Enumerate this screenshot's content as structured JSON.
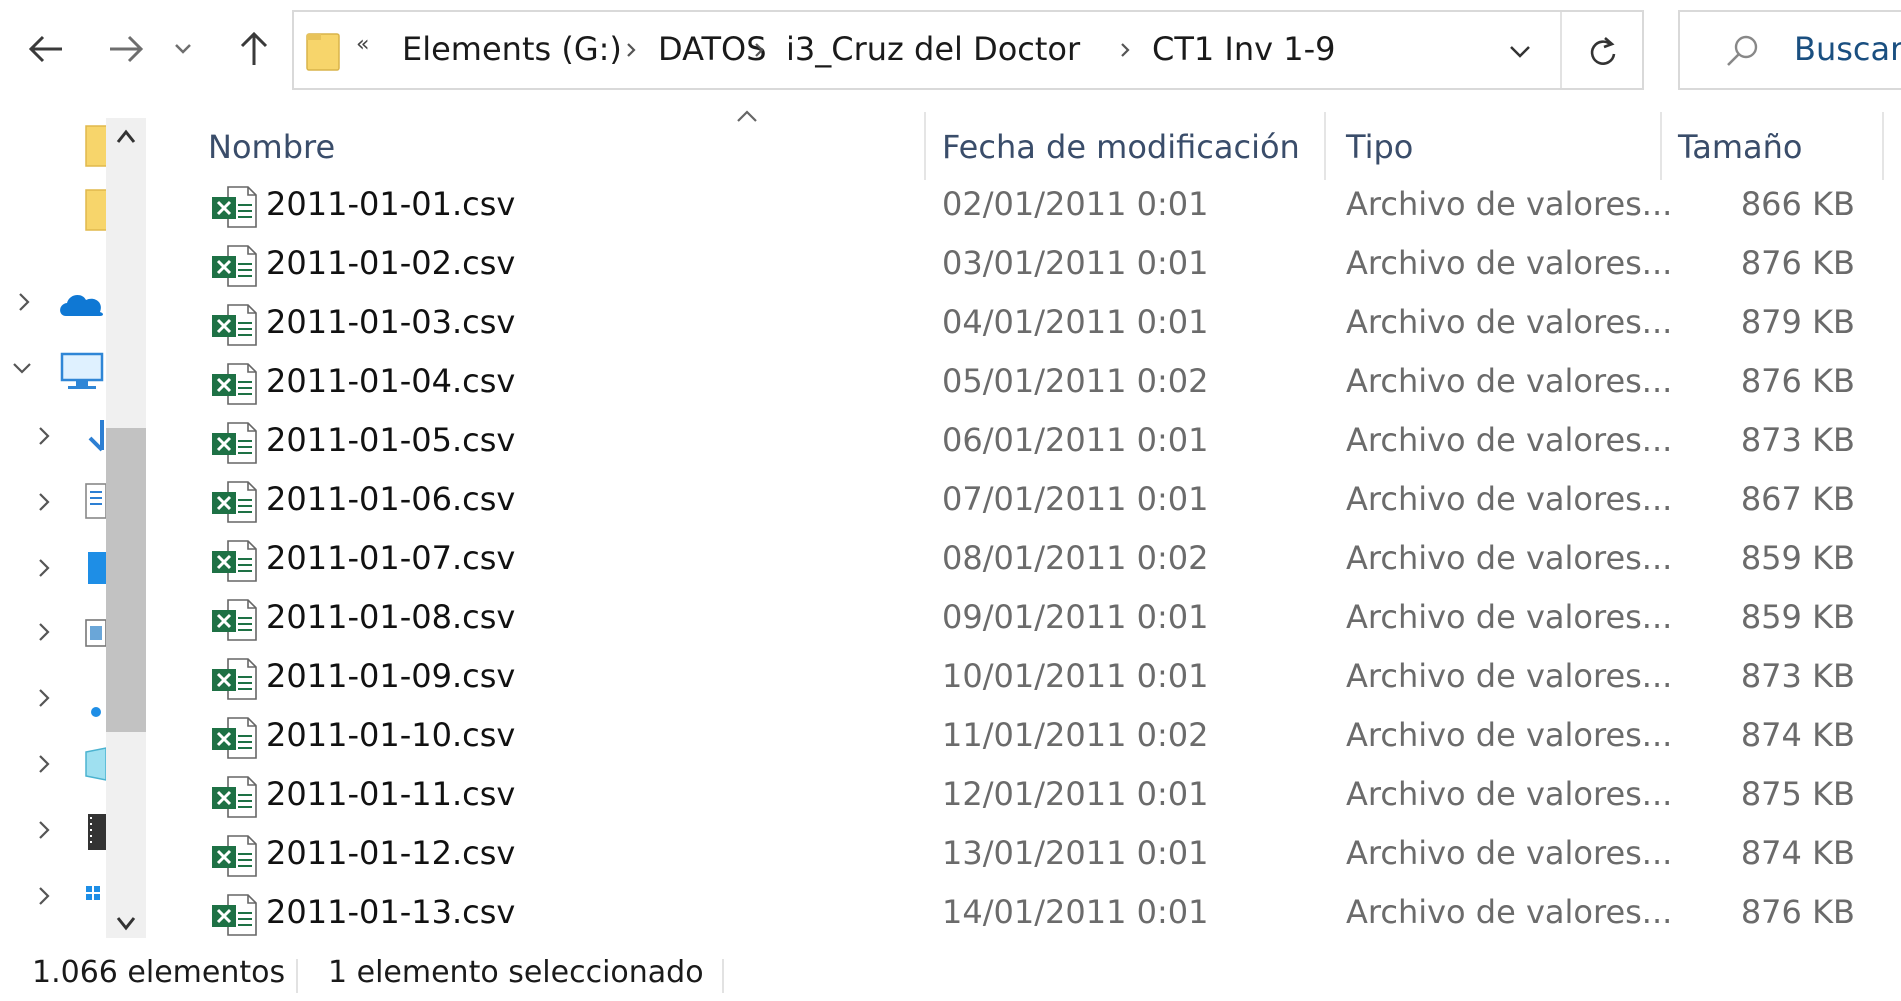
{
  "nav": {
    "back_icon": "arrow-left-icon",
    "forward_icon": "arrow-right-icon",
    "recent_icon": "chevron-down-icon",
    "up_icon": "arrow-up-icon"
  },
  "address": {
    "overflow": "«",
    "crumbs": [
      "Elements (G:)",
      "DATOS",
      "i3_Cruz del Doctor",
      "CT1 Inv 1-9"
    ]
  },
  "search": {
    "placeholder": "Buscar"
  },
  "columns": {
    "name": "Nombre",
    "date": "Fecha de modificación",
    "type": "Tipo",
    "size": "Tamaño"
  },
  "files": [
    {
      "name": "2011-01-01.csv",
      "date": "02/01/2011 0:01",
      "type": "Archivo de valores...",
      "size": "866 KB"
    },
    {
      "name": "2011-01-02.csv",
      "date": "03/01/2011 0:01",
      "type": "Archivo de valores...",
      "size": "876 KB"
    },
    {
      "name": "2011-01-03.csv",
      "date": "04/01/2011 0:01",
      "type": "Archivo de valores...",
      "size": "879 KB"
    },
    {
      "name": "2011-01-04.csv",
      "date": "05/01/2011 0:02",
      "type": "Archivo de valores...",
      "size": "876 KB"
    },
    {
      "name": "2011-01-05.csv",
      "date": "06/01/2011 0:01",
      "type": "Archivo de valores...",
      "size": "873 KB"
    },
    {
      "name": "2011-01-06.csv",
      "date": "07/01/2011 0:01",
      "type": "Archivo de valores...",
      "size": "867 KB"
    },
    {
      "name": "2011-01-07.csv",
      "date": "08/01/2011 0:02",
      "type": "Archivo de valores...",
      "size": "859 KB"
    },
    {
      "name": "2011-01-08.csv",
      "date": "09/01/2011 0:01",
      "type": "Archivo de valores...",
      "size": "859 KB"
    },
    {
      "name": "2011-01-09.csv",
      "date": "10/01/2011 0:01",
      "type": "Archivo de valores...",
      "size": "873 KB"
    },
    {
      "name": "2011-01-10.csv",
      "date": "11/01/2011 0:02",
      "type": "Archivo de valores...",
      "size": "874 KB"
    },
    {
      "name": "2011-01-11.csv",
      "date": "12/01/2011 0:01",
      "type": "Archivo de valores...",
      "size": "875 KB"
    },
    {
      "name": "2011-01-12.csv",
      "date": "13/01/2011 0:01",
      "type": "Archivo de valores...",
      "size": "874 KB"
    },
    {
      "name": "2011-01-13.csv",
      "date": "14/01/2011 0:01",
      "type": "Archivo de valores...",
      "size": "876 KB"
    }
  ],
  "status": {
    "count": "1.066 elementos",
    "selection": "1 elemento seleccionado"
  },
  "colors": {
    "excel_green": "#1e7145",
    "folder_yellow": "#f7d56b",
    "onedrive_blue": "#0f78d4"
  }
}
